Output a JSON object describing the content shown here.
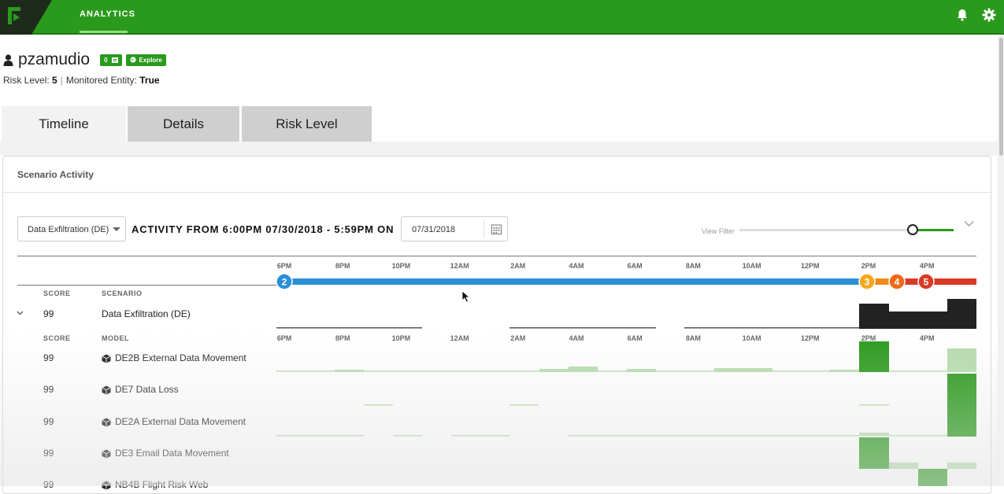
{
  "nav": {
    "tab": "ANALYTICS"
  },
  "user": {
    "name": "pzamudio",
    "badge_count": "0",
    "explore_label": "Explore"
  },
  "meta": {
    "risk_label": "Risk Level:",
    "risk_value": "5",
    "monitored_label": "Monitored Entity:",
    "monitored_value": "True"
  },
  "tabs": [
    "Timeline",
    "Details",
    "Risk Level"
  ],
  "panel": {
    "title": "Scenario Activity"
  },
  "controls": {
    "scenario_select": "Data Exfiltration (DE)",
    "activity_label": "ACTIVITY FROM 6:00PM 07/30/2018 - 5:59PM ON",
    "date_value": "07/31/2018",
    "view_filter_label": "View Filter",
    "view_filter_level": 0.8
  },
  "timeline": {
    "ticks": [
      "6PM",
      "8PM",
      "10PM",
      "12AM",
      "2AM",
      "4AM",
      "6AM",
      "8AM",
      "10AM",
      "12PM",
      "2PM",
      "4PM"
    ],
    "risk_markers": [
      {
        "label": "2",
        "color": "#2b8fd6"
      },
      {
        "label": "3",
        "color": "#f5a81c"
      },
      {
        "label": "4",
        "color": "#ee6a1a"
      },
      {
        "label": "5",
        "color": "#d93a26"
      }
    ],
    "colors": {
      "blue": "#2b8fd6",
      "orange": "#f08a1c",
      "red": "#d93a26",
      "green": "#2a9a1c",
      "light_green": "#b6dcae",
      "dark": "#222222"
    }
  },
  "scenario_table": {
    "headers": {
      "score": "SCORE",
      "scenario": "SCENARIO"
    },
    "row": {
      "score": "99",
      "name": "Data Exfiltration (DE)"
    }
  },
  "model_table": {
    "headers": {
      "score": "SCORE",
      "model": "MODEL"
    },
    "rows": [
      {
        "score": "99",
        "name": "DE2B External Data Movement"
      },
      {
        "score": "99",
        "name": "DE7 Data Loss"
      },
      {
        "score": "99",
        "name": "DE2A External Data Movement"
      },
      {
        "score": "99",
        "name": "DE3 Email Data Movement"
      },
      {
        "score": "99",
        "name": "NB4B Flight Risk Web"
      }
    ]
  }
}
